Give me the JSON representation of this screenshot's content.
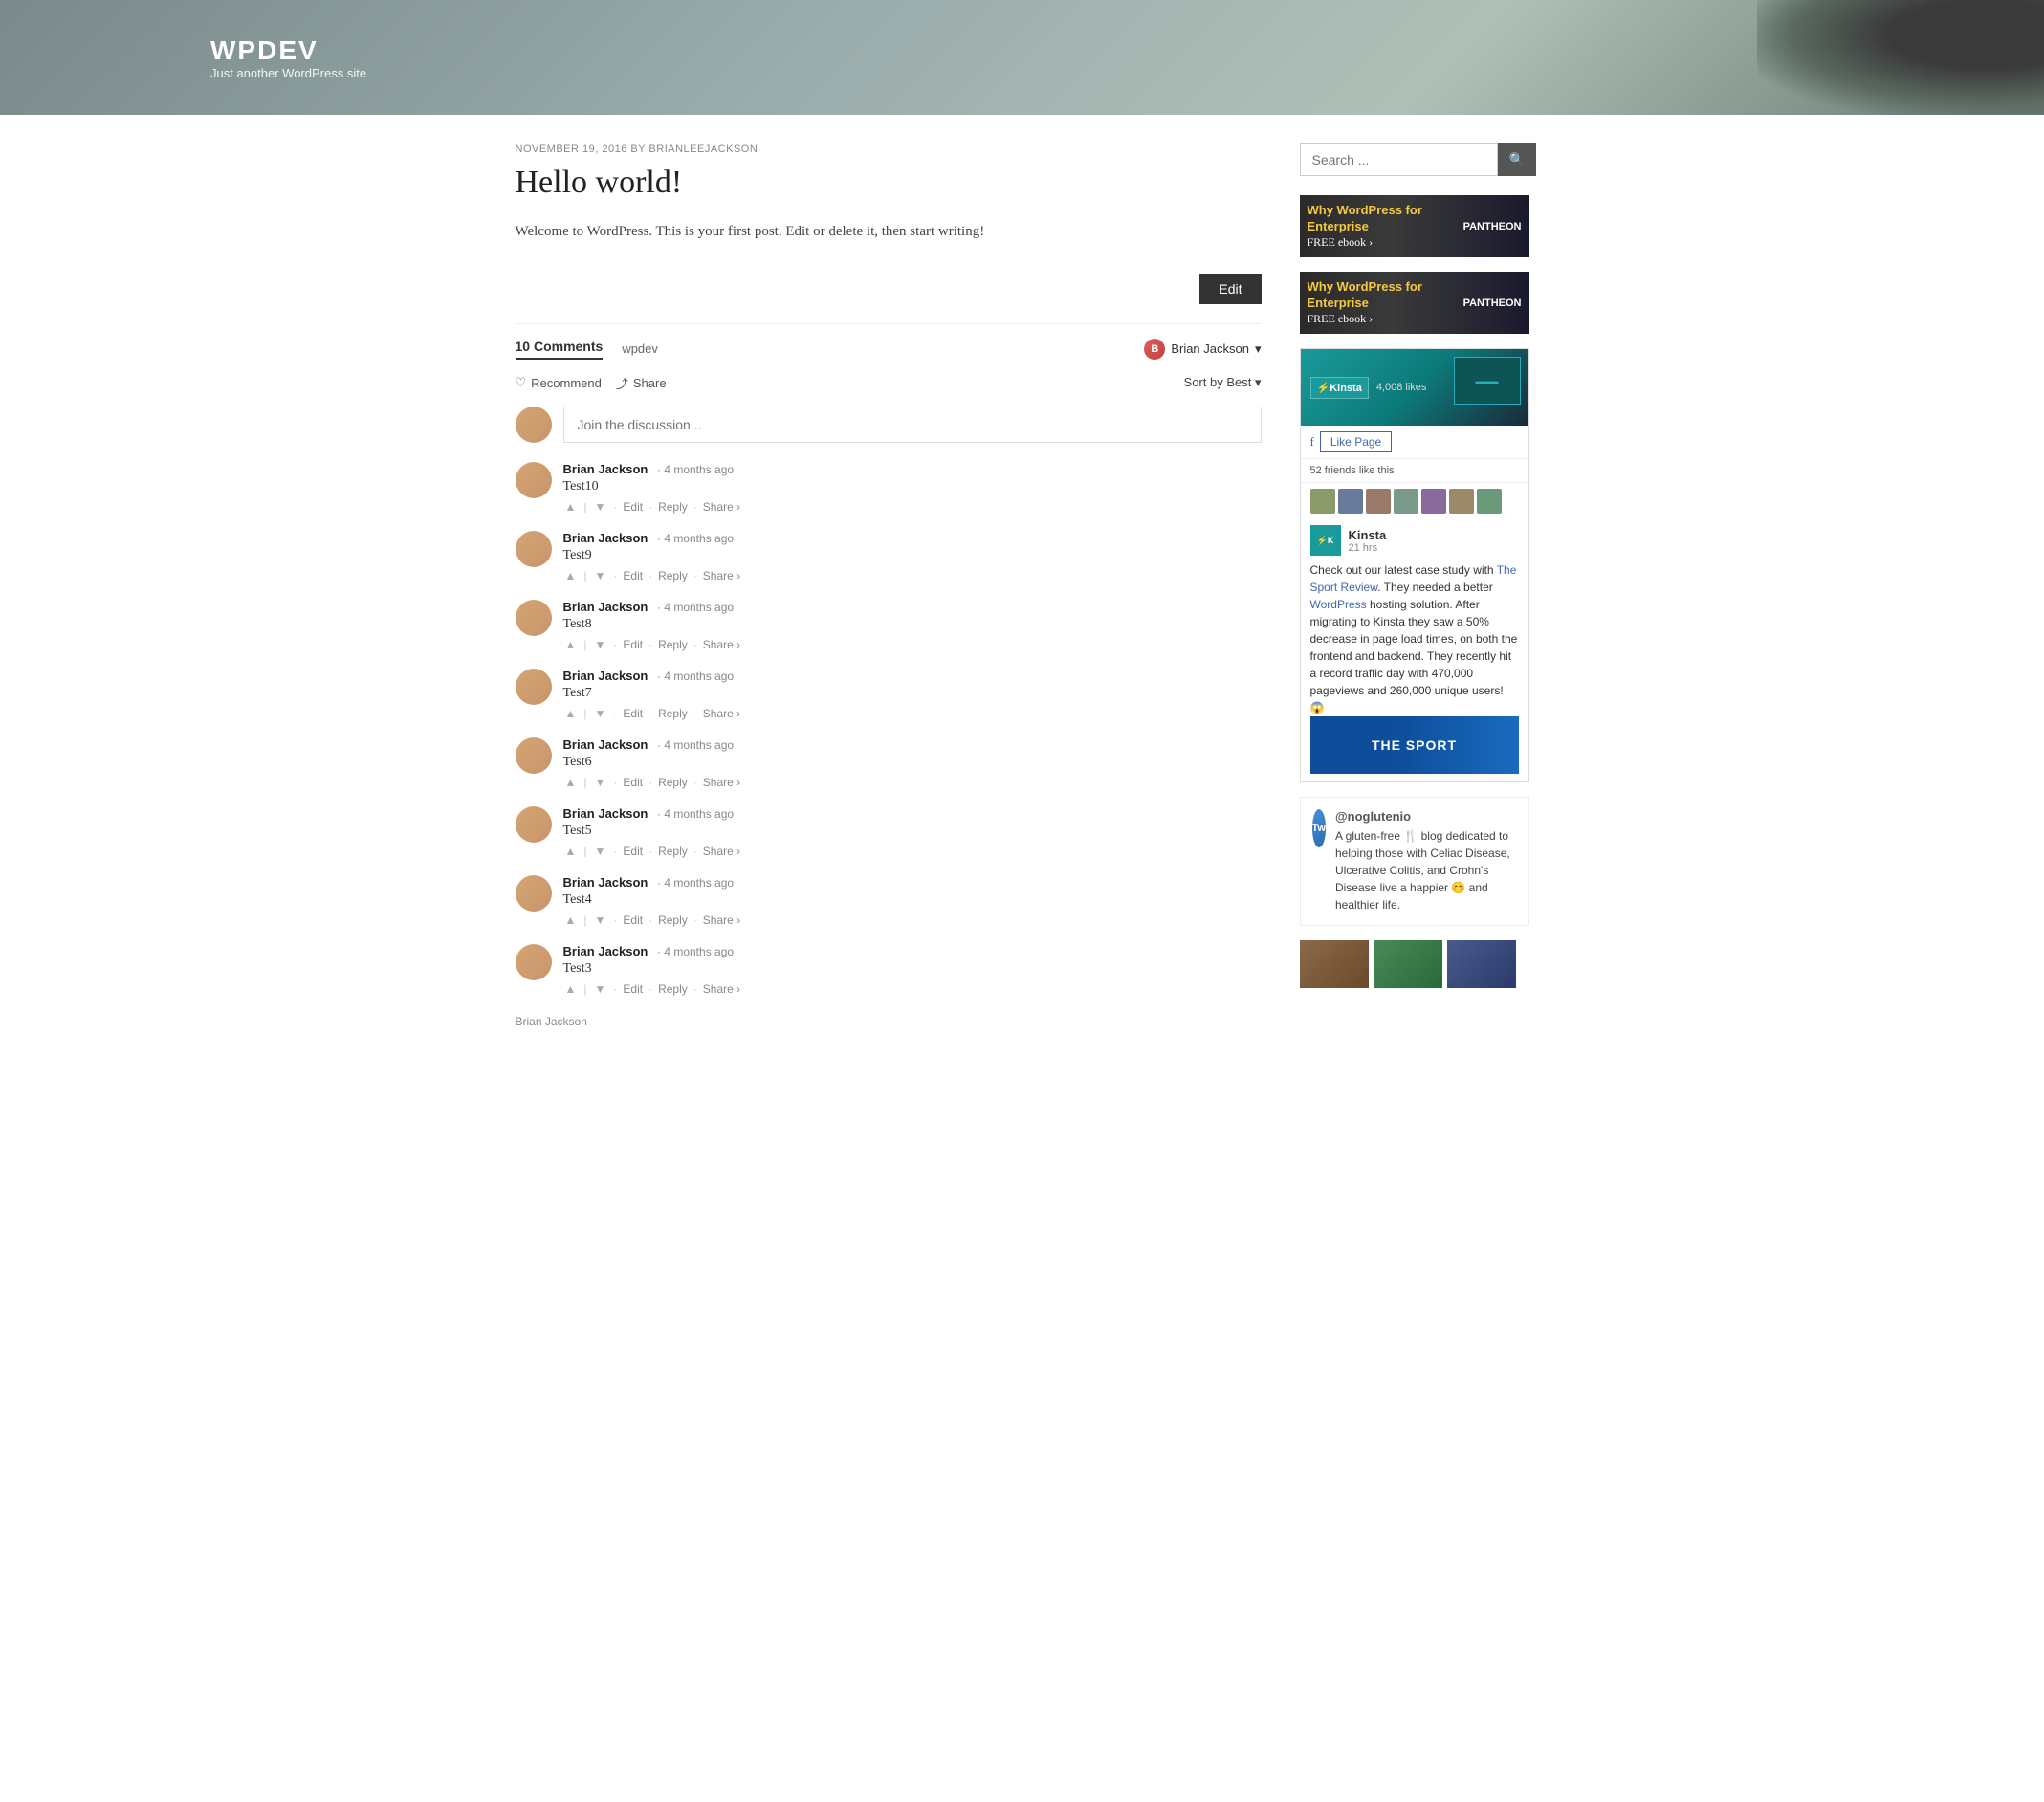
{
  "site": {
    "title": "WPDEV",
    "tagline": "Just another WordPress site"
  },
  "post": {
    "meta": "NOVEMBER 19, 2016 BY BRIANLEEJACKSON",
    "title": "Hello world!",
    "body": "Welcome to WordPress. This is your first post. Edit or delete it, then start writing!",
    "edit_label": "Edit"
  },
  "comments": {
    "count_label": "10 Comments",
    "site_label": "wpdev",
    "user_label": "Brian Jackson",
    "sort_label": "Sort by Best",
    "recommend_label": "Recommend",
    "share_label": "Share",
    "discussion_placeholder": "Join the discussion...",
    "items": [
      {
        "author": "Brian Jackson",
        "time": "4 months ago",
        "text": "Test10"
      },
      {
        "author": "Brian Jackson",
        "time": "4 months ago",
        "text": "Test9"
      },
      {
        "author": "Brian Jackson",
        "time": "4 months ago",
        "text": "Test8"
      },
      {
        "author": "Brian Jackson",
        "time": "4 months ago",
        "text": "Test7"
      },
      {
        "author": "Brian Jackson",
        "time": "4 months ago",
        "text": "Test6"
      },
      {
        "author": "Brian Jackson",
        "time": "4 months ago",
        "text": "Test5"
      },
      {
        "author": "Brian Jackson",
        "time": "4 months ago",
        "text": "Test4"
      },
      {
        "author": "Brian Jackson",
        "time": "4 months ago",
        "text": "Test3"
      }
    ],
    "action_labels": {
      "edit": "Edit",
      "reply": "Reply",
      "share": "Share ›"
    }
  },
  "sidebar": {
    "search_placeholder": "Search ...",
    "banner1": {
      "title": "Why WordPress for Enterprise",
      "cta": "FREE ebook ›",
      "logo": "PANTHEON"
    },
    "banner2": {
      "title": "Why WordPress for Enterprise",
      "cta": "FREE ebook ›",
      "logo": "PANTHEON"
    },
    "facebook": {
      "page_name": "Kinsta",
      "likes": "4,008 likes",
      "like_page_label": "Like Page",
      "friends_text": "52 friends like this",
      "post_time": "21 hrs",
      "post_text": "Check out our latest case study with The Sport Review. They needed a better WordPress hosting solution. After migrating to Kinsta they saw a 50% decrease in page load times, on both the frontend and backend. They recently hit a record traffic day with 470,000 pageviews and 260,000 unique users! 😱",
      "sport_label": "THE SPORT"
    },
    "twitter": {
      "handle": "@noglutenio",
      "text": "A gluten-free 🍴 blog dedicated to helping those with Celiac Disease, Ulcerative Colitis, and Crohn's Disease live a happier 😊 and healthier life."
    }
  },
  "footer_author": "Brian Jackson"
}
